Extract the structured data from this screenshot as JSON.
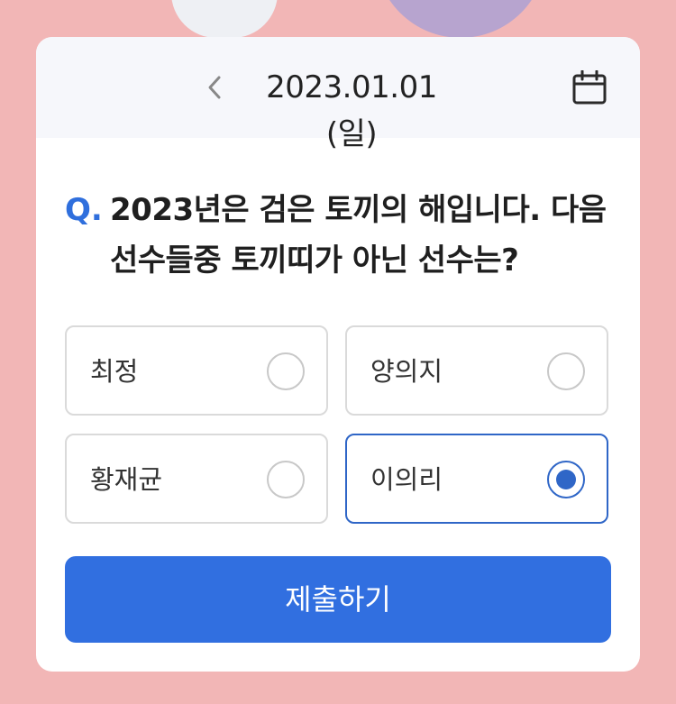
{
  "header": {
    "date": "2023.01.01 (일)"
  },
  "quiz": {
    "prefix": "Q.",
    "question": "2023년은 검은 토끼의 해입니다. 다음 선수들중 토끼띠가 아닌 선수는?",
    "options": [
      {
        "label": "최정",
        "selected": false
      },
      {
        "label": "양의지",
        "selected": false
      },
      {
        "label": "황재균",
        "selected": false
      },
      {
        "label": "이의리",
        "selected": true
      }
    ],
    "submit_label": "제출하기"
  },
  "icons": {
    "prev": "chevron-left-icon",
    "calendar": "calendar-icon",
    "radio_empty": "radio-unchecked-icon",
    "radio_selected": "radio-checked-icon"
  },
  "colors": {
    "background": "#f2b6b6",
    "accent": "#316fe0",
    "selected_border": "#2f66c7"
  }
}
